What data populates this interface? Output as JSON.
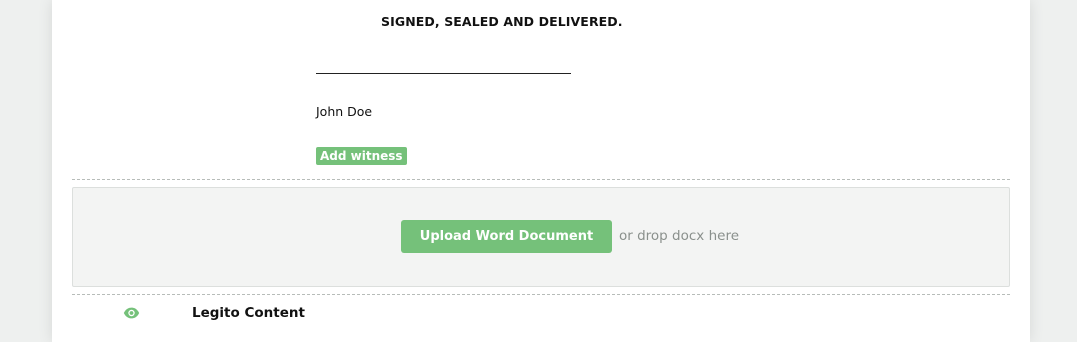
{
  "document": {
    "heading": "SIGNED, SEALED AND DELIVERED.",
    "signer_name": "John Doe",
    "add_witness_label": "Add witness"
  },
  "upload": {
    "button_label": "Upload Word Document",
    "drop_hint": "or drop docx here"
  },
  "section": {
    "icon": "eye-icon",
    "title": "Legito Content"
  },
  "colors": {
    "accent_green": "#75c17a",
    "page_background": "#eef0ef",
    "dropzone_background": "#f3f4f3",
    "hint_text": "#8a908c"
  }
}
